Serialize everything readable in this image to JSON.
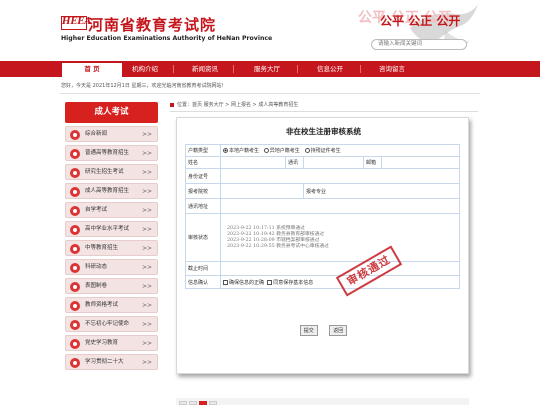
{
  "header": {
    "logo_text": "HEEA",
    "title": "河南省教育考试院",
    "subtitle": "Higher Education Examinations Authority of HeNan Province",
    "slogan_ghost": "公平 公正 公开",
    "slogan": "公平 公正 公开",
    "search_placeholder": "请输入新闻关键词"
  },
  "nav": [
    "首 页",
    "机构介绍",
    "新闻资讯",
    "服务大厅",
    "信息公开",
    "咨询留言"
  ],
  "topbar": {
    "text": "您好，今天是 2021年12月1日 星期三，欢迎光临河南省教育考试院网站！"
  },
  "sidebar": {
    "title": "成人考试",
    "items": [
      {
        "label": "综合新闻",
        "arrow": ">>"
      },
      {
        "label": "普通高等教育招生",
        "arrow": ">>"
      },
      {
        "label": "研究生招生考试",
        "arrow": ">>"
      },
      {
        "label": "成人高等教育招生",
        "arrow": ">>"
      },
      {
        "label": "自学考试",
        "arrow": ">>"
      },
      {
        "label": "高中学业水平考试",
        "arrow": ">>"
      },
      {
        "label": "中等教育招生",
        "arrow": ">>"
      },
      {
        "label": "科研动态",
        "arrow": ">>"
      },
      {
        "label": "表图制卷",
        "arrow": ">>"
      },
      {
        "label": "教师资格考试",
        "arrow": ">>"
      },
      {
        "label": "不忘初心牢记使命",
        "arrow": ">>"
      },
      {
        "label": "党史学习教育",
        "arrow": ">>"
      },
      {
        "label": "学习贯彻二十大",
        "arrow": ">>"
      }
    ]
  },
  "breadcrumb": "位置：首页 服务大厅 > 网上报名 > 成人高等教育招生",
  "form": {
    "title": "非在校生注册审核系统",
    "labels": {
      "hukou": "户籍类型",
      "name": "姓名",
      "address": "通讯",
      "email": "邮箱",
      "idcard": "身份证号",
      "school": "报考院校",
      "major": "报考专业",
      "mail_addr": "通讯地址",
      "status": "审核状态",
      "time": "截止时间",
      "confirm": "信息确认"
    },
    "hukou_options": [
      "本地户籍考生",
      "异地户籍考生",
      "持残证件考生"
    ],
    "status_log": [
      "2023-9-22 10:17:11 系统预审通过",
      "2023-9-22 10:19:42 教务县教育部审核通过",
      "2023-9-22 10:28:09 市辖档案部审核通过",
      "2023-9-22 10:29:55 教务县考试中心审核通过"
    ],
    "stamp": "审核通过",
    "confirm_options": [
      "确保信息的正确",
      "同意保存基本信息"
    ],
    "buttons": {
      "submit": "提交",
      "back": "返回"
    }
  }
}
